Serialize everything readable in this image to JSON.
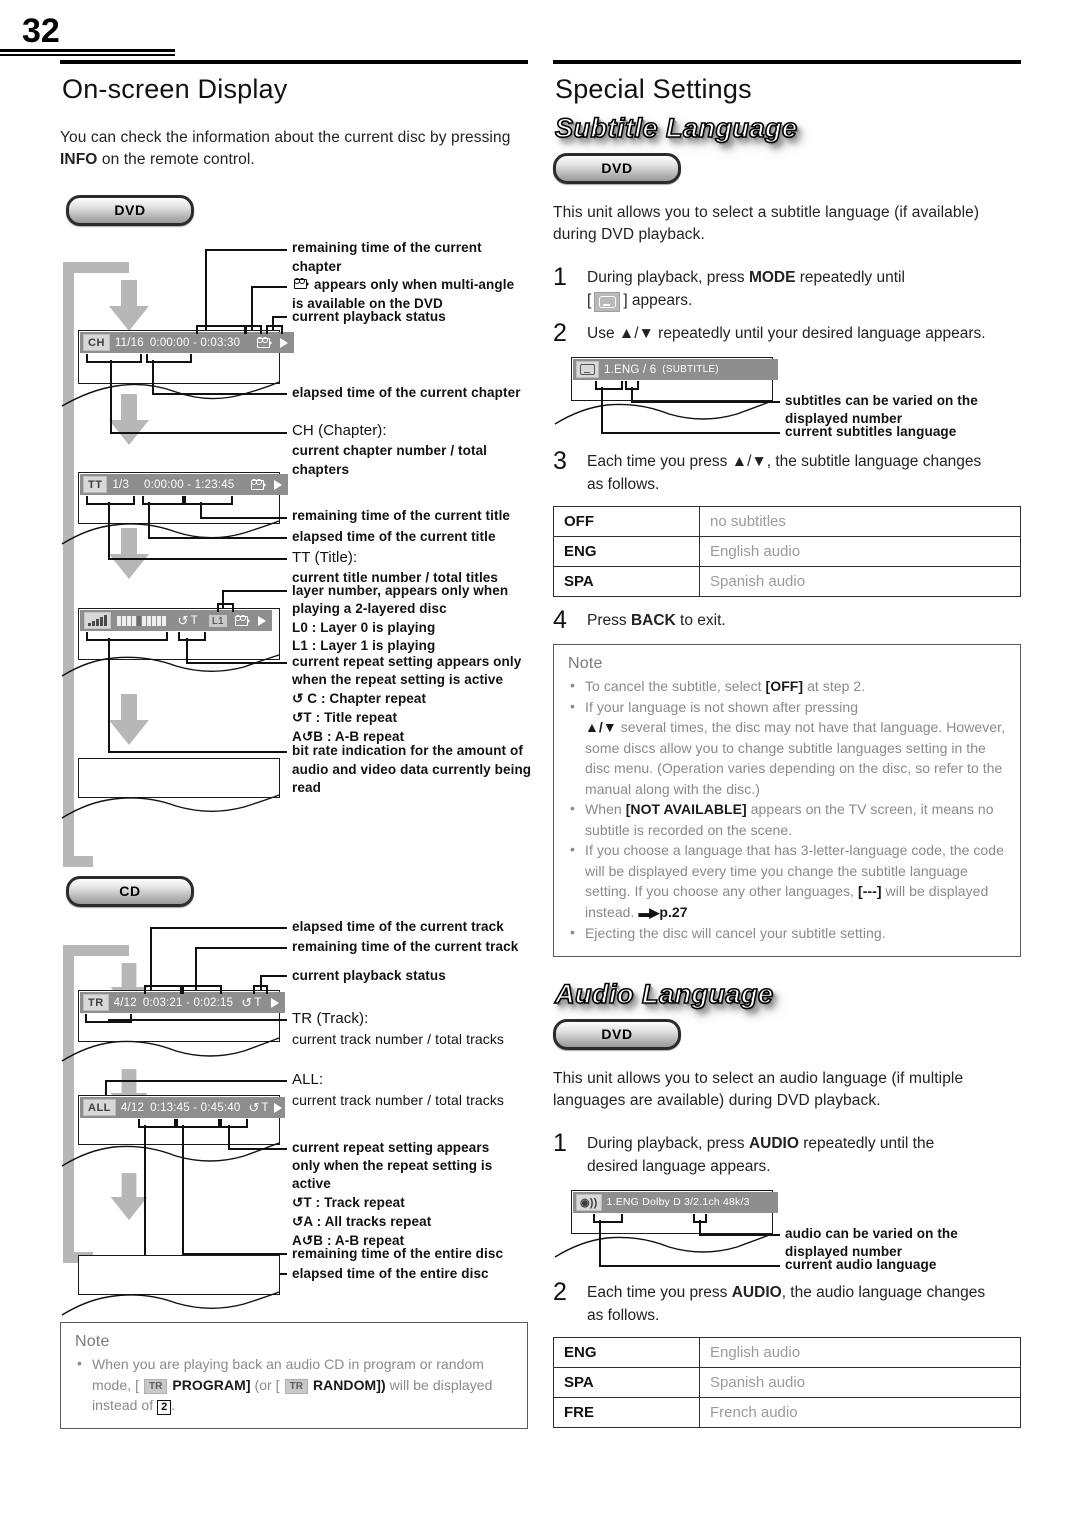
{
  "page": {
    "number": "32"
  },
  "left": {
    "heading": "On-screen Display",
    "intro_a": "You can check the information about the current disc by pressing ",
    "intro_b": "INFO",
    "intro_c": " on the remote control.",
    "badge_dvd": "DVD",
    "badge_cd": "CD",
    "osd_ch": {
      "tag": "CH",
      "counter": "11/16",
      "time": "0:00:00 - 0:03:30"
    },
    "osd_tt": {
      "tag": "TT",
      "counter": "1/3",
      "time": "0:00:00 - 1:23:45",
      "layer": "L1"
    },
    "osd_bitrate": {
      "repeat": "T"
    },
    "osd_tr": {
      "tag": "TR",
      "counter": "4/12",
      "time": "0:03:21 - 0:02:15",
      "repeat": "T"
    },
    "osd_all": {
      "tag": "ALL",
      "counter": "4/12",
      "time": "0:13:45 - 0:45:40",
      "repeat": "T"
    },
    "labels": {
      "remaining_chapter": "remaining time of the current chapter",
      "multi_angle": "appears only when multi-angle is available on the DVD",
      "playback_status": "current playback status",
      "elapsed_chapter": "elapsed time of the current chapter",
      "ch_title": "CH (Chapter):",
      "ch_sub": "current chapter number / total chapters",
      "remaining_title": "remaining time of the current title",
      "elapsed_title": "elapsed time of the current title",
      "tt_title": "TT (Title):",
      "tt_sub": "current title number / total titles",
      "layer_1": "layer number, appears only when",
      "layer_2": "playing a 2-layered disc",
      "layer_l0": "L0 :   Layer 0 is playing",
      "layer_l1": "L1 :   Layer 1 is playing",
      "repeat_dvd_1": "current repeat setting appears only",
      "repeat_dvd_2": "when the repeat setting is active",
      "repeat_dvd_c": "C :  Chapter repeat",
      "repeat_dvd_t": "T :  Title repeat",
      "repeat_dvd_ab": "B : A-B repeat",
      "bitrate": "bit rate indication for the amount of audio and video data currently being read",
      "elapsed_track": "elapsed time of the current track",
      "remaining_track": "remaining time of the current track",
      "playback_status_cd": "current playback status",
      "tr_title": "TR (Track):",
      "tr_sub": "current track number / total tracks",
      "all_title": "ALL:",
      "all_sub": "current track number / total tracks",
      "repeat_cd_1": "current repeat setting appears",
      "repeat_cd_2": "only when the repeat setting is",
      "repeat_cd_3": "active",
      "repeat_cd_t": "T :   Track repeat",
      "repeat_cd_a": "A :  All tracks repeat",
      "repeat_cd_ab": "B : A-B repeat",
      "remaining_disc": "remaining time of the entire disc",
      "elapsed_disc": "elapsed time of the entire disc"
    },
    "note": {
      "title": "Note",
      "bullet_1a": "When you are playing back an audio CD in program or random mode, [ ",
      "bullet_1tag": "TR",
      "bullet_1b": " PROGRAM]",
      "bullet_1c": " (or [ ",
      "bullet_1tag2": "TR",
      "bullet_1d": " RANDOM])",
      "bullet_1e": " will be displayed instead of ",
      "bullet_1num": "2",
      "bullet_1f": "."
    }
  },
  "right": {
    "heading": "Special Settings",
    "subtitle_section": {
      "title": "Subtitle Language",
      "badge": "DVD",
      "intro": "This unit allows you to select a subtitle language (if available) during DVD playback.",
      "step1_a": "During playback, press ",
      "step1_b": "MODE",
      "step1_c": " repeatedly until",
      "step1_d": "[",
      "step1_e": "] appears.",
      "step2": "Use ▲/▼ repeatedly until your desired language appears.",
      "osd": {
        "value": "1.ENG / 6",
        "suffix": "(SUBTITLE)"
      },
      "lbl_varied_1": "subtitles can be varied on the",
      "lbl_varied_2": "displayed number",
      "lbl_current": "current subtitles language",
      "step3_a": "Each time you press ▲/▼, the subtitle language changes",
      "step3_b": "as follows.",
      "table": [
        {
          "code": "OFF",
          "desc": "no subtitles"
        },
        {
          "code": "ENG",
          "desc": "English audio"
        },
        {
          "code": "SPA",
          "desc": "Spanish audio"
        }
      ],
      "step4_a": "Press ",
      "step4_b": "BACK",
      "step4_c": " to exit.",
      "note": {
        "title": "Note",
        "b1_a": "To cancel the subtitle, select ",
        "b1_k": "[OFF]",
        "b1_b": " at step 2.",
        "b2_a": "If your language is not shown after pressing",
        "b2_b": "▲/▼",
        "b2_c": " several times, the disc may not have that language. However, some discs allow you to change subtitle languages setting in the disc menu. (Operation varies depending on the disc, so refer to the manual along with the disc.)",
        "b3_a": "When ",
        "b3_k": "[NOT AVAILABLE]",
        "b3_b": " appears on the TV screen, it means no subtitle is recorded on the scene.",
        "b4_a": "If you choose a language that has 3-letter-language code, the code will be displayed every time you change the subtitle language setting. If you choose any other languages, ",
        "b4_k": "[---]",
        "b4_b": " will be displayed instead. ",
        "b4_page": "p.27",
        "b5": "Ejecting the disc will cancel your subtitle setting."
      }
    },
    "audio_section": {
      "title": "Audio Language",
      "badge": "DVD",
      "intro": "This unit allows you to select an audio language (if multiple languages are available) during DVD playback.",
      "step1_a": "During playback, press ",
      "step1_b": "AUDIO",
      "step1_c": " repeatedly until the",
      "step1_d": "desired language appears.",
      "osd": {
        "value": "1.ENG Dolby D 3/2.1ch  48k/3"
      },
      "lbl_varied_1": "audio can be varied on the",
      "lbl_varied_2": "displayed number",
      "lbl_current": "current audio language",
      "step2_a": "Each time you press ",
      "step2_b": "AUDIO",
      "step2_c": ", the audio language changes",
      "step2_d": "as follows.",
      "table": [
        {
          "code": "ENG",
          "desc": "English audio"
        },
        {
          "code": "SPA",
          "desc": "Spanish audio"
        },
        {
          "code": "FRE",
          "desc": "French audio"
        }
      ]
    }
  }
}
